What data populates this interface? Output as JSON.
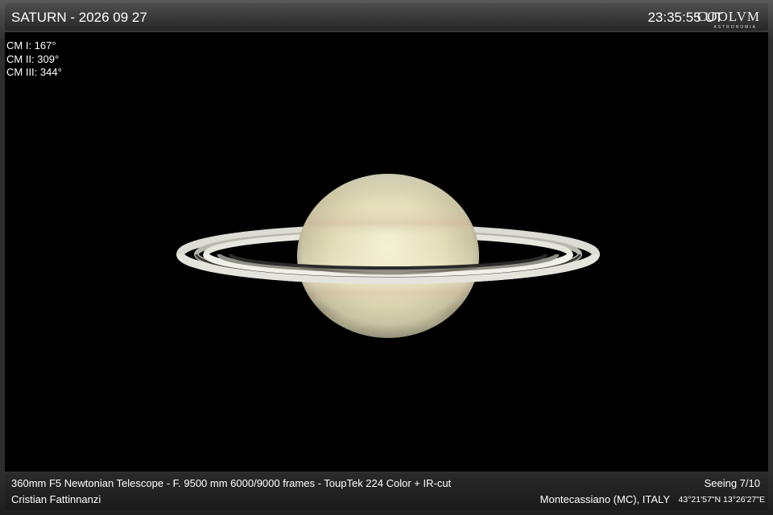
{
  "header": {
    "title": "SATURN - 2026 09 27",
    "time": "23:35:55 UT",
    "logo": "COOLVM",
    "logo_sub": "ASTRONOMIA"
  },
  "central_meridians": [
    {
      "label": "CM I: 167°"
    },
    {
      "label": "CM II: 309°"
    },
    {
      "label": "CM III: 344°"
    }
  ],
  "footer": {
    "equipment": "360mm F5 Newtonian Telescope - F. 9500 mm  6000/9000 frames - ToupTek 224 Color + IR-cut",
    "observer": "Cristian Fattinnanzi",
    "seeing": "Seeing 7/10",
    "location": "Montecassiano (MC), ITALY",
    "coordinates": "43°21'57\"N 13°26'27\"E"
  },
  "colors": {
    "background": "#000000",
    "frame": "#2e2e2e",
    "text": "#ffffff"
  },
  "image": {
    "subject": "planet-saturn-with-rings"
  }
}
